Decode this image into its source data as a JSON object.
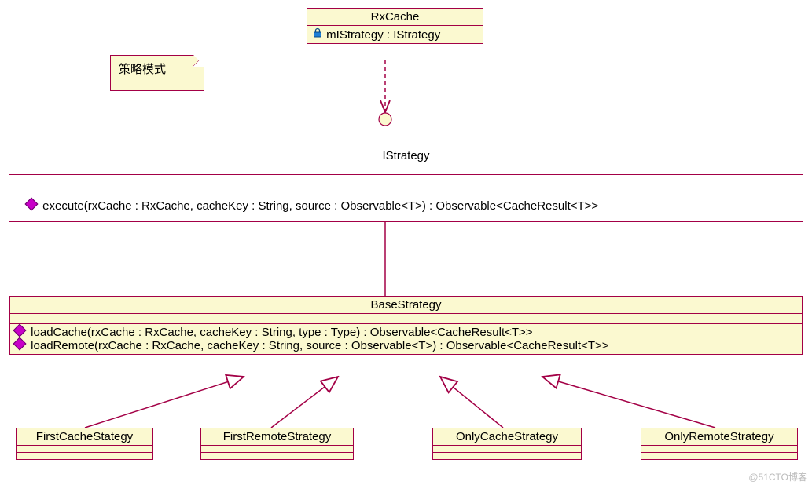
{
  "note": {
    "text": "策略模式"
  },
  "rxcache": {
    "name": "RxCache",
    "attr": "mIStrategy : IStrategy"
  },
  "istrategy": {
    "name": "IStrategy",
    "op": "execute(rxCache : RxCache, cacheKey : String, source : Observable<T>) : Observable<CacheResult<T>>"
  },
  "basestrategy": {
    "name": "BaseStrategy",
    "op1": "loadCache(rxCache : RxCache, cacheKey : String, type : Type) : Observable<CacheResult<T>>",
    "op2": "loadRemote(rxCache : RxCache, cacheKey : String, source : Observable<T>) : Observable<CacheResult<T>>"
  },
  "sub": {
    "a": "FirstCacheStategy",
    "b": "FirstRemoteStrategy",
    "c": "OnlyCacheStrategy",
    "d": "OnlyRemoteStrategy"
  },
  "watermark": "@51CTO博客"
}
